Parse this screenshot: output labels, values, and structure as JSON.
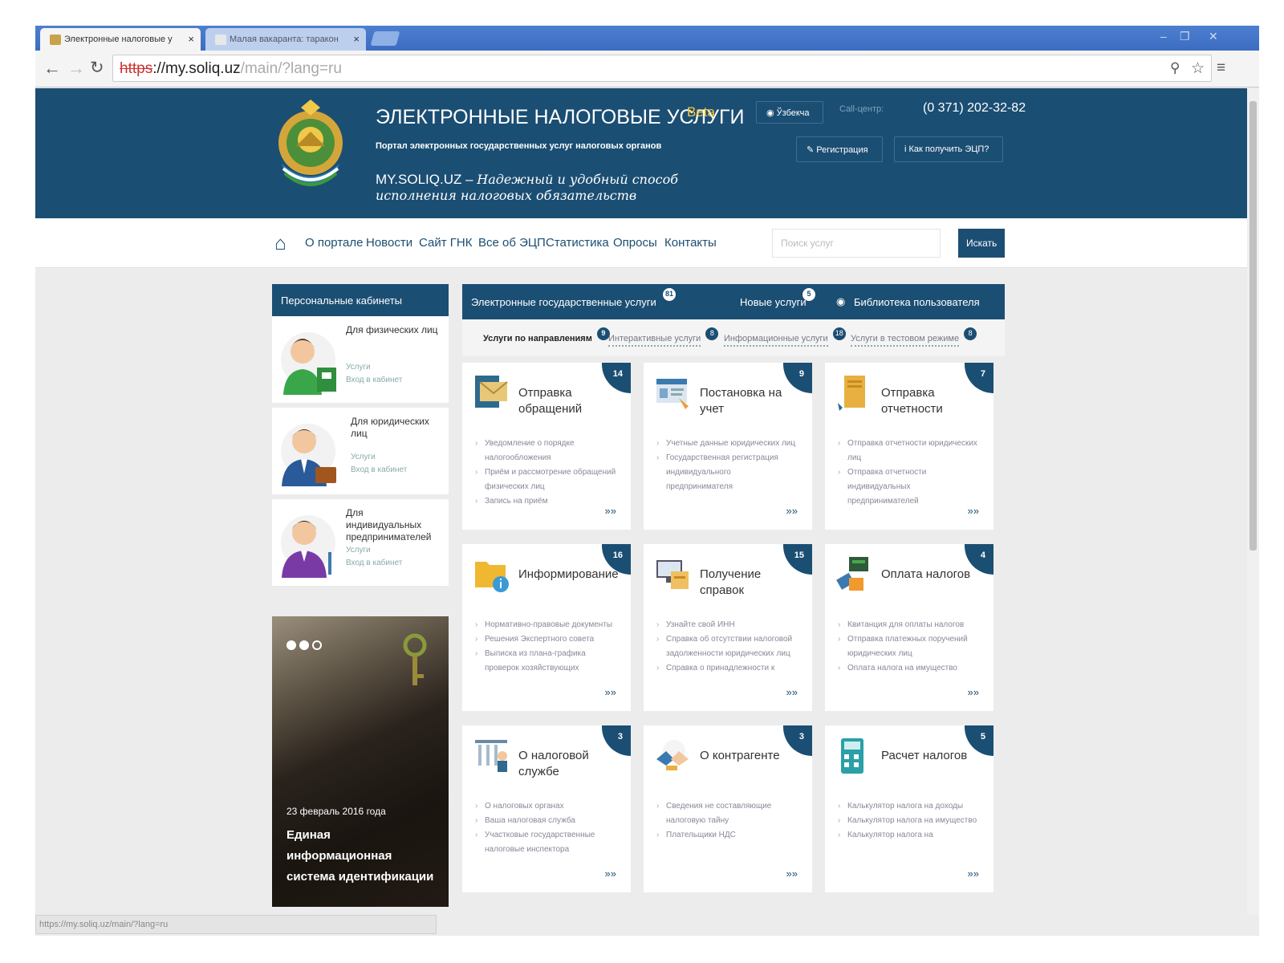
{
  "browser": {
    "tabs": [
      {
        "title": "Электронные налоговые у"
      },
      {
        "title": "Малая вакаранта: таракон"
      }
    ],
    "url": {
      "scheme": "https",
      "host": "://my.soliq.uz",
      "path": "/main/?lang=ru"
    },
    "status_url": "https://my.soliq.uz/main/?lang=ru"
  },
  "header": {
    "title": "ЭЛЕКТРОННЫЕ НАЛОГОВЫЕ УСЛУГИ",
    "beta": "Beta",
    "subtitle": "Портал электронных государственных услуг налоговых органов",
    "tagline_site": "MY.SOLIQ.UZ  –",
    "tagline": "Надежный и удобный способ исполнения налоговых обязательств",
    "language": "Ўзбекча",
    "callcenter_label": "Call-центр:",
    "phone": "(0 371) 202-32-82",
    "register_label": "Регистрация",
    "ecp_label": "Как получить ЭЦП?"
  },
  "nav": {
    "items": [
      "О портале",
      "Новости",
      "Сайт ГНК",
      "Все об ЭЦП",
      "Статистика",
      "Опросы",
      "Контакты"
    ],
    "search_placeholder": "Поиск услуг",
    "search_button": "Искать"
  },
  "cabinets": {
    "title": "Персональные кабинеты",
    "items": [
      {
        "title": "Для физических лиц",
        "services": "Услуги",
        "login": "Вход в кабинет"
      },
      {
        "title": "Для юридических лиц",
        "services": "Услуги",
        "login": "Вход в кабинет"
      },
      {
        "title": "Для индивидуальных предпринимателей",
        "services": "Услуги",
        "login": "Вход в кабинет"
      }
    ]
  },
  "slider": {
    "date": "23 февраль 2016 года",
    "title": "Единая информационная система идентификации"
  },
  "eservices": {
    "title": "Электронные государственные услуги",
    "title_count": "81",
    "new_label": "Новые услуги",
    "new_count": "5",
    "library_label": "Библиотека пользователя",
    "subtabs": [
      {
        "label": "Услуги по направлениям",
        "count": "9"
      },
      {
        "label": "Интерактивные услуги",
        "count": "8"
      },
      {
        "label": "Информационные услуги",
        "count": "18"
      },
      {
        "label": "Услуги в тестовом режиме",
        "count": "8"
      }
    ],
    "more": "»»",
    "cards": [
      {
        "title": "Отправка обращений",
        "count": "14",
        "icon": "envelope-icon",
        "items": [
          "Уведомление о порядке налогообложения",
          "Приём и рассмотрение обращений физических лиц",
          "Запись на приём"
        ]
      },
      {
        "title": "Постановка на учет",
        "count": "9",
        "icon": "registration-card-icon",
        "items": [
          "Учетные данные юридических лиц",
          "Государственная регистрация индивидуального предпринимателя"
        ]
      },
      {
        "title": "Отправка отчетности",
        "count": "7",
        "icon": "report-folder-icon",
        "items": [
          "Отправка отчетности юридических лиц",
          "Отправка отчетности индивидуальных предпринимателей"
        ]
      },
      {
        "title": "Информирование",
        "count": "16",
        "icon": "info-folder-icon",
        "items": [
          "Нормативно-правовые документы",
          "Решения Экспертного совета",
          "Выписка из плана-графика проверок хозяйствующих"
        ]
      },
      {
        "title": "Получение справок",
        "count": "15",
        "icon": "computer-docs-icon",
        "items": [
          "Узнайте свой ИНН",
          "Справка об отсутствии налоговой задолженности юридических лиц",
          "Справка о принадлежности к"
        ]
      },
      {
        "title": "Оплата налогов",
        "count": "4",
        "icon": "payment-cards-icon",
        "items": [
          "Квитанция для оплаты налогов",
          "Отправка платежных поручений юридических лиц",
          "Оплата налога на имущество"
        ]
      },
      {
        "title": "О налоговой службе",
        "count": "3",
        "icon": "building-icon",
        "items": [
          "О налоговых органах",
          "Ваша налоговая служба",
          "Участковые государственные налоговые инспектора"
        ]
      },
      {
        "title": "О контрагенте",
        "count": "3",
        "icon": "handshake-icon",
        "items": [
          "Сведения не составляющие налоговую тайну",
          "Плательщики НДС"
        ]
      },
      {
        "title": "Расчет налогов",
        "count": "5",
        "icon": "calculator-icon",
        "items": [
          "Калькулятор налога на доходы",
          "Калькулятор налога на имущество",
          "Калькулятор налога на"
        ]
      }
    ]
  },
  "colors": {
    "brand": "#1b4e73",
    "accent": "#f5c842"
  }
}
